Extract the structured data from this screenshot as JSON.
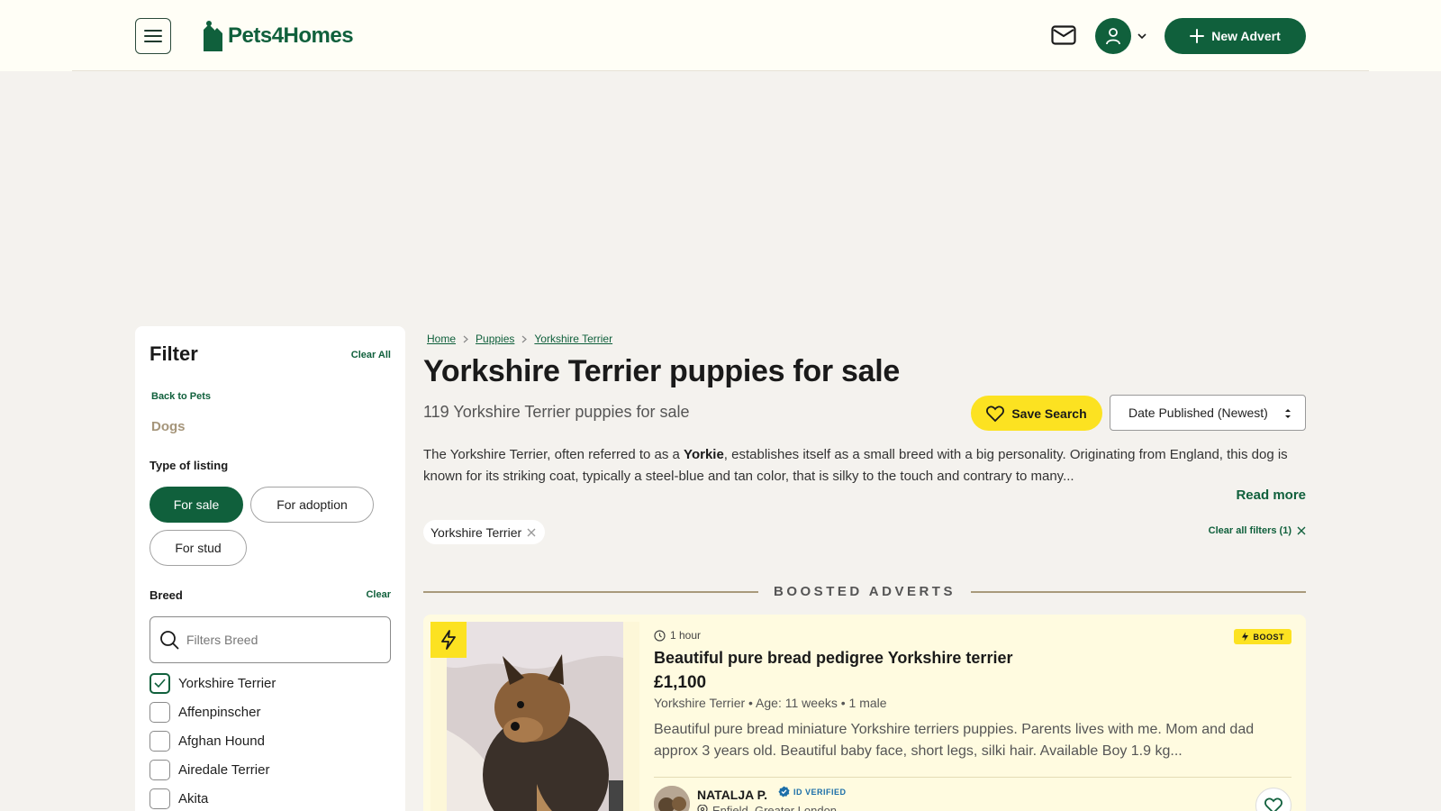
{
  "header": {
    "logo_text": "Pets4Homes",
    "new_advert_label": "New Advert",
    "brand_color": "#10603c"
  },
  "sidebar": {
    "title": "Filter",
    "clear_all": "Clear All",
    "back_label": "Back to Pets",
    "category": "Dogs",
    "type_title": "Type of listing",
    "types": [
      {
        "label": "For sale",
        "active": true
      },
      {
        "label": "For adoption",
        "active": false
      },
      {
        "label": "For stud",
        "active": false
      }
    ],
    "breed_title": "Breed",
    "breed_clear": "Clear",
    "breed_placeholder": "Filters Breed",
    "breeds": [
      {
        "label": "Yorkshire Terrier",
        "checked": true
      },
      {
        "label": "Affenpinscher",
        "checked": false
      },
      {
        "label": "Afghan Hound",
        "checked": false
      },
      {
        "label": "Airedale Terrier",
        "checked": false
      },
      {
        "label": "Akita",
        "checked": false
      }
    ]
  },
  "main": {
    "breadcrumb": [
      "Home",
      "Puppies",
      "Yorkshire Terrier"
    ],
    "title": "Yorkshire Terrier puppies for sale",
    "subtitle": "119 Yorkshire Terrier puppies for sale",
    "save_search": "Save Search",
    "sort_value": "Date Published (Newest)",
    "desc_pre": "The Yorkshire Terrier, often referred to as a ",
    "desc_bold": "Yorkie",
    "desc_post": ", establishes itself as a small breed with a big personality. Originating from England, this dog is known for its striking coat, typically a steel-blue and tan color, that is silky to the touch and contrary to many...",
    "read_more": "Read more",
    "active_chip": "Yorkshire Terrier",
    "clear_filters": "Clear all filters (1)",
    "boosted_heading": "BOOSTED ADVERTS"
  },
  "card": {
    "time": "1 hour",
    "boost_label": "BOOST",
    "title": "Beautiful pure bread pedigree Yorkshire terrier",
    "price": "£1,100",
    "meta": "Yorkshire Terrier • Age: 11 weeks • 1 male",
    "description": "Beautiful pure bread miniature Yorkshire terriers puppies. Parents lives with me. Mom and dad approx 3 years old. Beautiful baby face, short legs, silki hair. Available Boy 1.9 kg...",
    "seller_name": "NATALJA P.",
    "verified_label": "ID VERIFIED",
    "location": "Enfield, Greater London"
  },
  "icons": {
    "menu": "hamburger-icon",
    "mail": "mail-icon",
    "user": "user-icon",
    "plus": "plus-icon",
    "heart": "heart-icon",
    "search": "search-icon",
    "check": "check-icon",
    "bolt": "bolt-icon",
    "clock": "clock-icon",
    "pin": "location-pin-icon"
  }
}
